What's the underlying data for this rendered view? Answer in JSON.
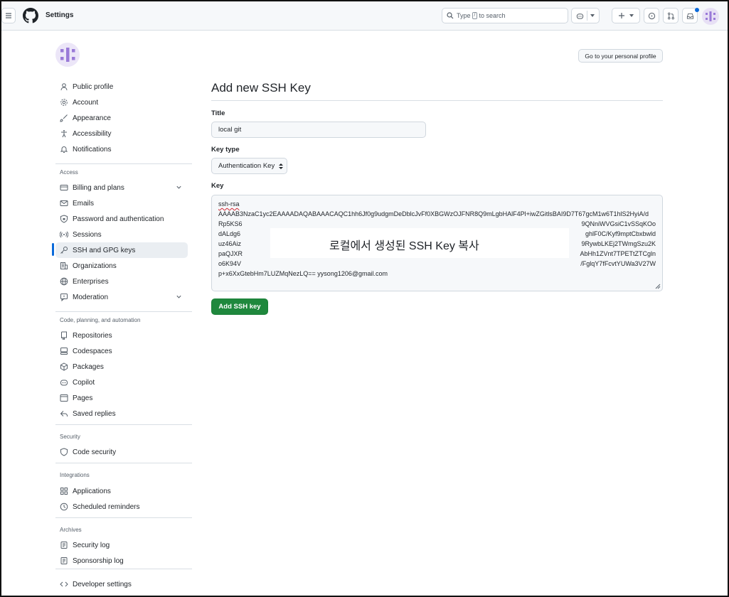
{
  "header": {
    "title": "Settings",
    "search_prefix": "Type",
    "search_key": "/",
    "search_suffix": "to search"
  },
  "sidebar": {
    "items_personal": [
      {
        "label": "Public profile",
        "icon": "person-icon"
      },
      {
        "label": "Account",
        "icon": "gear-icon"
      },
      {
        "label": "Appearance",
        "icon": "paintbrush-icon"
      },
      {
        "label": "Accessibility",
        "icon": "accessibility-icon"
      },
      {
        "label": "Notifications",
        "icon": "bell-icon"
      }
    ],
    "group_access": "Access",
    "items_access": [
      {
        "label": "Billing and plans",
        "icon": "credit-card-icon"
      },
      {
        "label": "Emails",
        "icon": "mail-icon"
      },
      {
        "label": "Password and authentication",
        "icon": "shield-lock-icon"
      },
      {
        "label": "Sessions",
        "icon": "broadcast-icon"
      },
      {
        "label": "SSH and GPG keys",
        "icon": "key-icon"
      },
      {
        "label": "Organizations",
        "icon": "organization-icon"
      },
      {
        "label": "Enterprises",
        "icon": "globe-icon"
      },
      {
        "label": "Moderation",
        "icon": "report-icon"
      }
    ],
    "group_code": "Code, planning, and automation",
    "items_code": [
      {
        "label": "Repositories",
        "icon": "repo-icon"
      },
      {
        "label": "Codespaces",
        "icon": "codespaces-icon"
      },
      {
        "label": "Packages",
        "icon": "package-icon"
      },
      {
        "label": "Copilot",
        "icon": "copilot-icon"
      },
      {
        "label": "Pages",
        "icon": "browser-icon"
      },
      {
        "label": "Saved replies",
        "icon": "reply-icon"
      }
    ],
    "group_security": "Security",
    "items_security": [
      {
        "label": "Code security",
        "icon": "shield-icon"
      }
    ],
    "group_integrations": "Integrations",
    "items_integrations": [
      {
        "label": "Applications",
        "icon": "apps-icon"
      },
      {
        "label": "Scheduled reminders",
        "icon": "clock-icon"
      }
    ],
    "group_archives": "Archives",
    "items_archives": [
      {
        "label": "Security log",
        "icon": "log-icon"
      },
      {
        "label": "Sponsorship log",
        "icon": "log-icon"
      }
    ],
    "items_dev": [
      {
        "label": "Developer settings",
        "icon": "code-icon"
      }
    ]
  },
  "main": {
    "profile_button": "Go to your personal profile",
    "page_title": "Add new SSH Key",
    "title_label": "Title",
    "title_value": "local git",
    "key_type_label": "Key type",
    "key_type_value": "Authentication Key",
    "key_label": "Key",
    "key_lines": {
      "l1": "ssh-rsa",
      "l2": "AAAAB3NzaC1yc2EAAAADAQABAAACAQC1hh6Jf0g9udgmDeDblcJvFf0XBGWzOJFNR8Q9mLgbHAlF4Pl+iwZGitlsBAI9D7T67gcM1w6T1hlS2HyiA/d",
      "l3a": "Rp5KS6",
      "l3b": "9QNniWVGsiC1vSSqKOo",
      "l4a": "dALdg6",
      "l4b": "ghlF0C/Kyf9mptCbxbwld",
      "l5a": "uz46Aiz",
      "l5b": "9RywbLKEj2TWmgSzu2K",
      "l6a": "paQJXR",
      "l6b": "AbHh1ZVnt7TPETtZTCgln",
      "l7a": "o6K94V",
      "l7b": "/FglqY7fFcvtYUWa3V27W",
      "l8": "p+x6XxGtebHm7LUZMqNezLQ== yysong1206@gmail.com"
    },
    "overlay_note": "로컬에서 생성된 SSH Key 복사",
    "add_button": "Add SSH key"
  },
  "colors": {
    "accent": "#0969da",
    "primary_button": "#1f883d",
    "border": "#d0d7de"
  }
}
